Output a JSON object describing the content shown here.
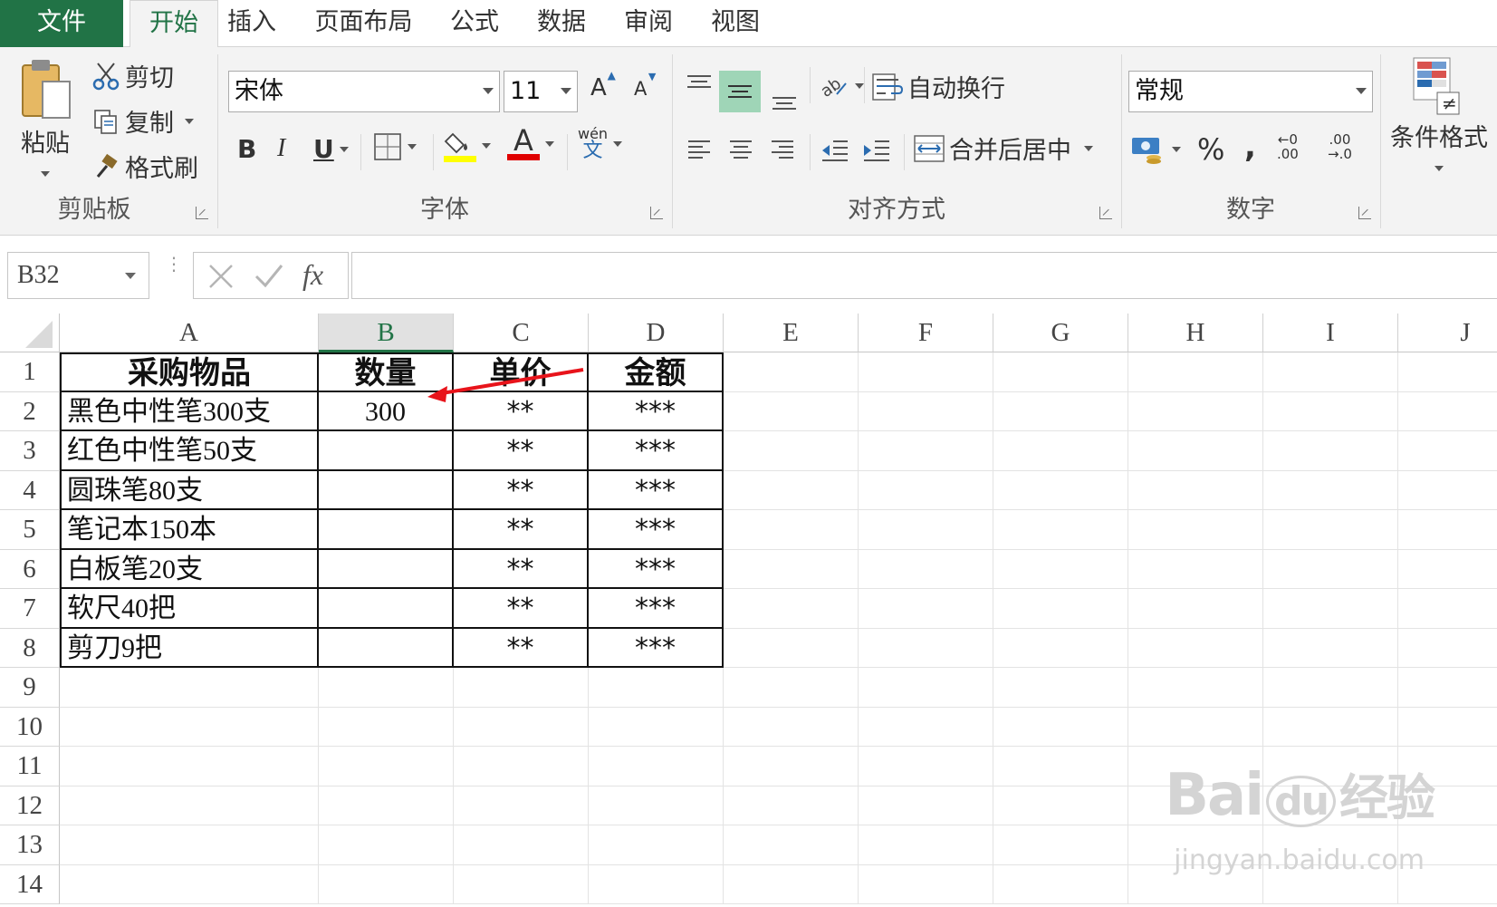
{
  "tabs": {
    "file": "文件",
    "home": "开始",
    "insert": "插入",
    "page_layout": "页面布局",
    "formulas": "公式",
    "data": "数据",
    "review": "审阅",
    "view": "视图"
  },
  "ribbon": {
    "clipboard": {
      "label": "剪贴板",
      "paste": "粘贴",
      "cut": "剪切",
      "copy": "复制",
      "format_painter": "格式刷"
    },
    "font": {
      "label": "字体",
      "font_name": "宋体",
      "font_size": "11",
      "bold": "B",
      "italic": "I",
      "underline": "U",
      "font_color_glyph": "A",
      "phonetic_top": "wén",
      "phonetic_bottom": "文",
      "highlight_color": "#ffff00",
      "font_color": "#e00000"
    },
    "alignment": {
      "label": "对齐方式",
      "wrap_text": "自动换行",
      "merge_center": "合并后居中"
    },
    "number": {
      "label": "数字",
      "format": "常规",
      "percent": "%",
      "comma": ",",
      "inc_decimal_top": "←0",
      "inc_decimal_bottom": ".00",
      "dec_decimal_top": ".00",
      "dec_decimal_bottom": "→.0"
    },
    "styles": {
      "conditional_format": "条件格式"
    }
  },
  "formula_bar": {
    "name_box": "B32",
    "fx": "fx",
    "content": ""
  },
  "sheet": {
    "columns": [
      "A",
      "B",
      "C",
      "D",
      "E",
      "F",
      "G",
      "H",
      "I",
      "J"
    ],
    "selected_column": "B",
    "rows": [
      "1",
      "2",
      "3",
      "4",
      "5",
      "6",
      "7",
      "8",
      "9",
      "10",
      "11",
      "12",
      "13",
      "14"
    ],
    "headers": [
      "采购物品",
      "数量",
      "单价",
      "金额"
    ],
    "data": [
      {
        "item": "黑色中性笔300支",
        "qty": "300",
        "price": "**",
        "amount": "***"
      },
      {
        "item": "红色中性笔50支",
        "qty": "",
        "price": "**",
        "amount": "***"
      },
      {
        "item": "圆珠笔80支",
        "qty": "",
        "price": "**",
        "amount": "***"
      },
      {
        "item": "笔记本150本",
        "qty": "",
        "price": "**",
        "amount": "***"
      },
      {
        "item": "白板笔20支",
        "qty": "",
        "price": "**",
        "amount": "***"
      },
      {
        "item": "软尺40把",
        "qty": "",
        "price": "**",
        "amount": "***"
      },
      {
        "item": "剪刀9把",
        "qty": "",
        "price": "**",
        "amount": "***"
      }
    ]
  },
  "annotation": {
    "arrow_color": "#e8141b"
  },
  "watermark": {
    "brand": "Bai",
    "paw": "du",
    "brand_cn": "经验",
    "url": "jingyan.baidu.com"
  },
  "colors": {
    "excel_green": "#217346",
    "ribbon_bg": "#f3f3f3",
    "active_align_bg": "#9fd5b7"
  }
}
